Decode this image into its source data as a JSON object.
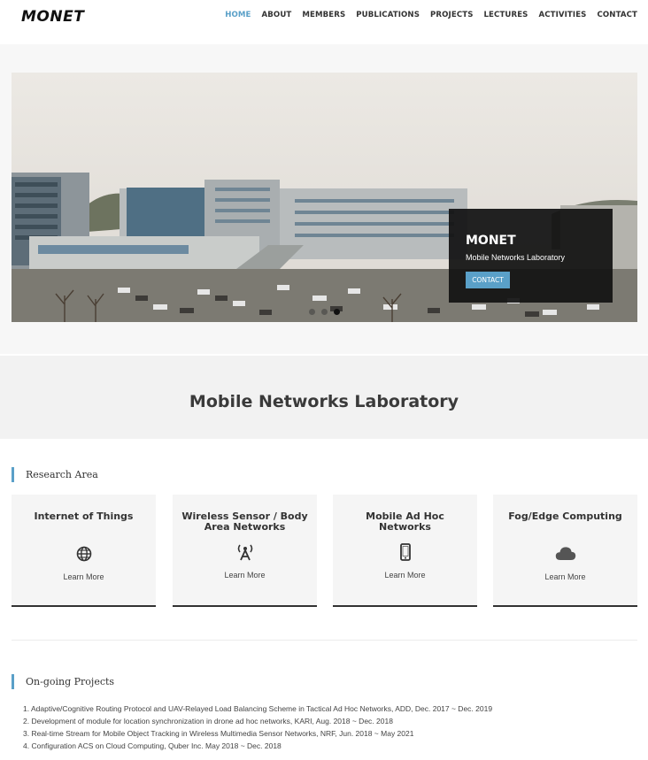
{
  "header": {
    "logo": "MONET",
    "nav": [
      {
        "label": "HOME",
        "active": true
      },
      {
        "label": "ABOUT",
        "active": false
      },
      {
        "label": "MEMBERS",
        "active": false
      },
      {
        "label": "PUBLICATIONS",
        "active": false
      },
      {
        "label": "PROJECTS",
        "active": false
      },
      {
        "label": "LECTURES",
        "active": false
      },
      {
        "label": "ACTIVITIES",
        "active": false
      },
      {
        "label": "CONTACT",
        "active": false
      }
    ]
  },
  "hero": {
    "caption_title": "MONET",
    "caption_subtitle": "Mobile Networks Laboratory",
    "caption_button": "CONTACT",
    "slide_count": 3,
    "active_slide": 3
  },
  "lab_title": "Mobile Networks Laboratory",
  "research": {
    "heading": "Research Area",
    "cards": [
      {
        "title": "Internet of Things",
        "icon": "globe-icon",
        "link": "Learn More"
      },
      {
        "title": "Wireless Sensor / Body Area Networks",
        "icon": "antenna-icon",
        "link": "Learn More"
      },
      {
        "title": "Mobile Ad Hoc Networks",
        "icon": "mobile-phone-icon",
        "link": "Learn More"
      },
      {
        "title": "Fog/Edge Computing",
        "icon": "cloud-icon",
        "link": "Learn More"
      }
    ]
  },
  "projects": {
    "heading": "On-going Projects",
    "items": [
      "1. Adaptive/Cognitive Routing Protocol and UAV-Relayed Load Balancing Scheme in Tactical Ad Hoc Networks, ADD, Dec. 2017 ~ Dec. 2019",
      "2. Development of module for location synchronization in drone ad hoc networks, KARI, Aug. 2018 ~ Dec. 2018",
      "3. Real-time Stream for Mobile Object Tracking in Wireless Multimedia Sensor Networks, NRF, Jun. 2018 ~ May 2021",
      "4. Configuration ACS on Cloud Computing, Quber Inc. May 2018 ~ Dec. 2018"
    ]
  },
  "colors": {
    "accent": "#5aa0c8",
    "caption_bg": "#121212",
    "band_bg": "#f2f2f2"
  }
}
